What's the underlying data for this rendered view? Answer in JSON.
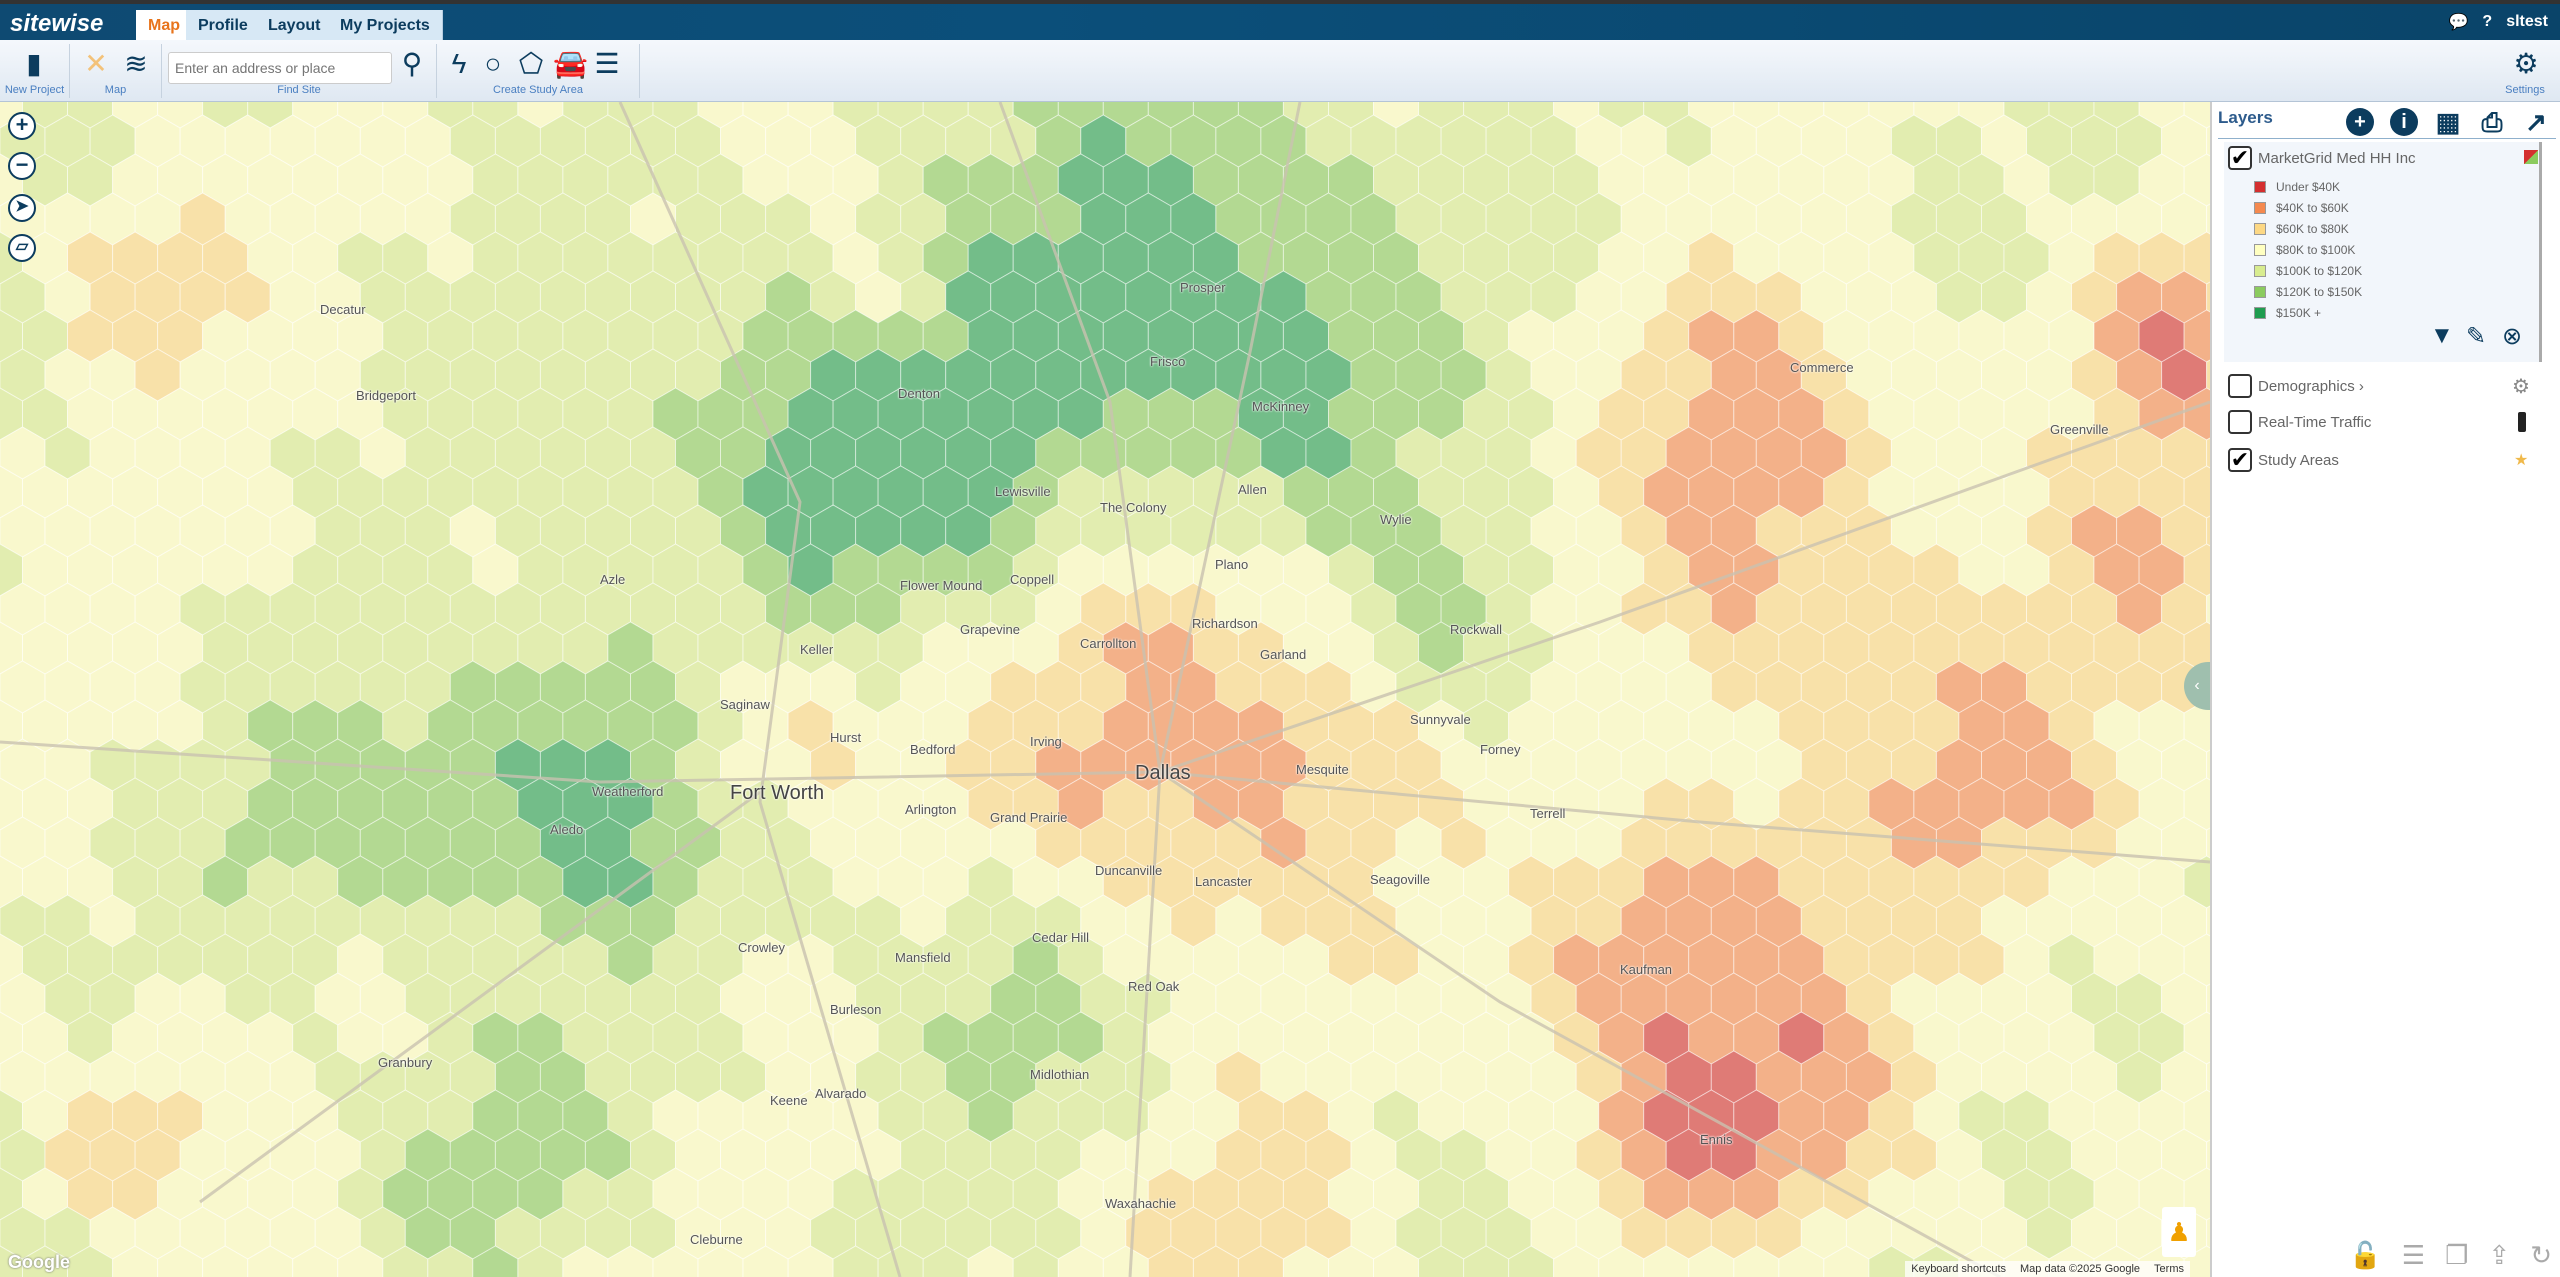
{
  "app": {
    "logo": "sitewise",
    "user": "sltest"
  },
  "tabs": [
    {
      "label": "Map",
      "active": true
    },
    {
      "label": "Profile"
    },
    {
      "label": "Layout"
    },
    {
      "label": "My Projects"
    }
  ],
  "toolbar": {
    "new_project": "New Project",
    "map": "Map",
    "find_site": "Find Site",
    "search_placeholder": "Enter an address or place",
    "create_study_area": "Create Study Area",
    "settings": "Settings"
  },
  "layers": {
    "title": "Layers",
    "marketgrid": {
      "name": "MarketGrid Med HH Inc",
      "checked": true,
      "legend": [
        {
          "label": "Under $40K",
          "color": "#d42f2f"
        },
        {
          "label": "$40K to $60K",
          "color": "#f5894f"
        },
        {
          "label": "$60K to $80K",
          "color": "#fdd884"
        },
        {
          "label": "$80K to $100K",
          "color": "#ffffc0"
        },
        {
          "label": "$100K to $120K",
          "color": "#d8ec8f"
        },
        {
          "label": "$120K to $150K",
          "color": "#8bcb5e"
        },
        {
          "label": "$150K +",
          "color": "#1f9c4f"
        }
      ]
    },
    "others": [
      {
        "name": "Demographics",
        "checked": false,
        "suffix": "›"
      },
      {
        "name": "Real-Time Traffic",
        "checked": false
      },
      {
        "name": "Study Areas",
        "checked": true
      }
    ]
  },
  "map": {
    "cities_major": [
      "Fort Worth",
      "Dallas"
    ],
    "cities": [
      "Arlington",
      "Irving",
      "Plano",
      "Garland",
      "Denton",
      "McKinney",
      "Frisco",
      "Allen",
      "Carrollton",
      "Richardson",
      "Grand Prairie",
      "Mansfield",
      "Waxahachie",
      "Mesquite",
      "Weatherford",
      "Lewisville",
      "Flower Mound",
      "Terrell",
      "Bridgeport",
      "Alvarado",
      "Midlothian",
      "Red Oak",
      "Lancaster",
      "Duncanville",
      "Cedar Hill",
      "Crowley",
      "Granbury",
      "Keene",
      "Aledo",
      "Keller",
      "Grapevine",
      "Rockwall",
      "Forney",
      "Seagoville",
      "Kaufman",
      "Commerce",
      "Greenville",
      "Ennis",
      "Cleburne",
      "Burleson",
      "Sunnyvale",
      "Wylie",
      "Prosper",
      "The Colony",
      "Decatur",
      "Azle",
      "Saginaw",
      "Hurst",
      "Bedford",
      "Coppell"
    ],
    "attribution": {
      "shortcuts": "Keyboard shortcuts",
      "data": "Map data ©2025 Google",
      "terms": "Terms"
    },
    "google": "Google"
  }
}
